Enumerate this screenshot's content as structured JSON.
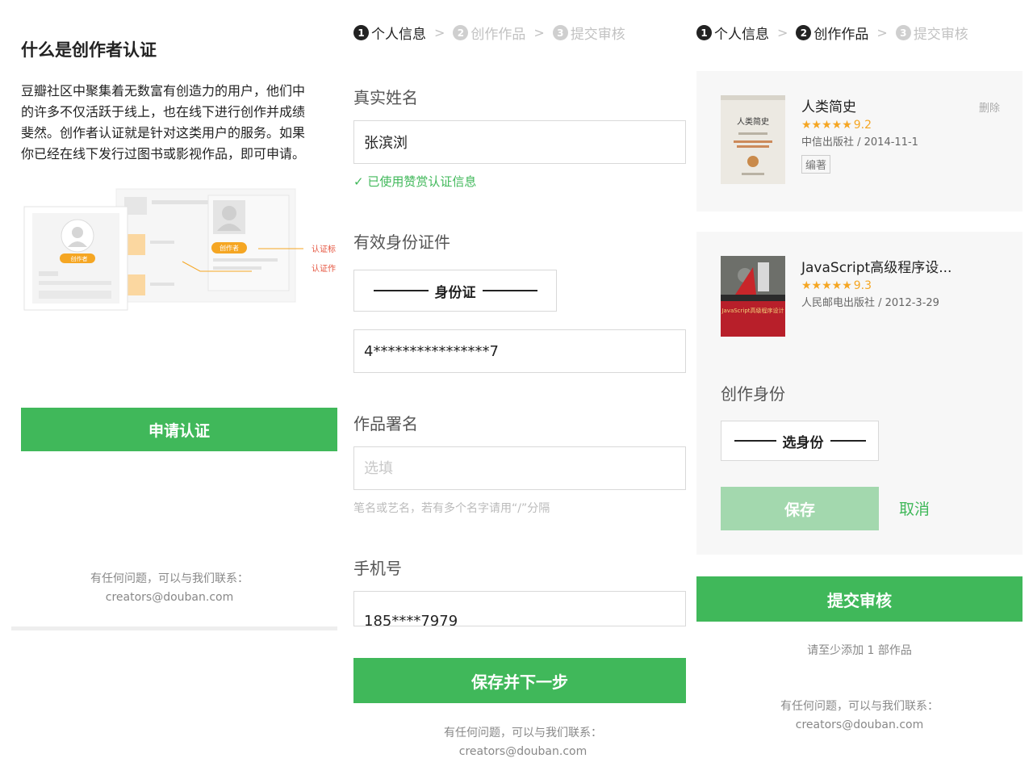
{
  "colors": {
    "accent": "#40b85a",
    "star": "#f5a623",
    "muted": "#888888"
  },
  "panel1": {
    "title": "什么是创作者认证",
    "description_lines": [
      "豆瓣社区中聚集着无数富有创造力的用户，他们中",
      "的许多不仅活跃于线上，也在线下进行创作并成绩",
      "斐然。创作者认证就是针对这类用户的服务。如果",
      "你已经在线下发行过图书或影视作品，即可申请。"
    ],
    "illustration": {
      "badge": "创作者",
      "callout_1": "认证标",
      "callout_2": "认证作"
    },
    "apply_button": "申请认证",
    "contact_line1": "有任何问题，可以与我们联系：",
    "contact_email": "creators@douban.com"
  },
  "steps": [
    {
      "num": "1",
      "label": "个人信息"
    },
    {
      "num": "2",
      "label": "创作作品"
    },
    {
      "num": "3",
      "label": "提交审核"
    }
  ],
  "step_separator": ">",
  "panel2": {
    "name_label": "真实姓名",
    "name_value": "张滨浏",
    "verified_text": "✓ 已使用赞赏认证信息",
    "id_label": "有效身份证件",
    "id_type": "身份证",
    "id_number": "4****************7",
    "pen_name_label": "作品署名",
    "pen_name_placeholder": "选填",
    "pen_name_hint": "笔名或艺名，若有多个名字请用“/”分隔",
    "phone_label": "手机号",
    "phone_value": "185****7979",
    "save_next_button": "保存并下一步",
    "contact_line1": "有任何问题，可以与我们联系：",
    "contact_email": "creators@douban.com"
  },
  "panel3": {
    "books": [
      {
        "title": "人类简史",
        "stars": "★★★★★",
        "score": "9.2",
        "publisher": "中信出版社 / 2014-11-1",
        "role": "编著",
        "delete": "删除",
        "cover_text": "人类简史"
      },
      {
        "title": "JavaScript高级程序设...",
        "stars": "★★★★★",
        "score": "9.3",
        "publisher": "人民邮电出版社 / 2012-3-29",
        "cover_text": "JavaScript高级程序设计"
      }
    ],
    "role_label": "创作身份",
    "role_select": "选身份",
    "save_button": "保存",
    "cancel_button": "取消",
    "submit_button": "提交审核",
    "min_works_note": "请至少添加 1 部作品",
    "contact_line1": "有任何问题，可以与我们联系：",
    "contact_email": "creators@douban.com"
  }
}
